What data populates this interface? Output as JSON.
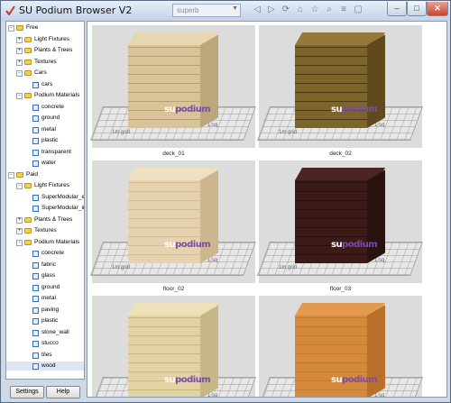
{
  "window": {
    "title": "SU Podium Browser V2",
    "toolbar_select": "superb"
  },
  "sidebar": {
    "tree": [
      {
        "label": "Free",
        "type": "folder",
        "level": 0,
        "expander": "-"
      },
      {
        "label": "Light Fixtures",
        "type": "folder",
        "level": 1,
        "expander": "+"
      },
      {
        "label": "Plants & Trees",
        "type": "folder",
        "level": 1,
        "expander": "+"
      },
      {
        "label": "Textures",
        "type": "folder",
        "level": 1,
        "expander": "+"
      },
      {
        "label": "Cars",
        "type": "folder",
        "level": 1,
        "expander": "-"
      },
      {
        "label": "cars",
        "type": "item",
        "level": 2
      },
      {
        "label": "Podium Materials",
        "type": "folder",
        "level": 1,
        "expander": "-"
      },
      {
        "label": "concrete",
        "type": "item",
        "level": 2
      },
      {
        "label": "ground",
        "type": "item",
        "level": 2
      },
      {
        "label": "metal",
        "type": "item",
        "level": 2
      },
      {
        "label": "plastic",
        "type": "item",
        "level": 2
      },
      {
        "label": "transparent",
        "type": "item",
        "level": 2
      },
      {
        "label": "water",
        "type": "item",
        "level": 2
      },
      {
        "label": "Paid",
        "type": "folder",
        "level": 0,
        "expander": "-"
      },
      {
        "label": "Light Fixtures",
        "type": "folder",
        "level": 1,
        "expander": "-"
      },
      {
        "label": "SuperModular_exterior",
        "type": "item",
        "level": 2
      },
      {
        "label": "SuperModular_interior",
        "type": "item",
        "level": 2
      },
      {
        "label": "Plants & Trees",
        "type": "folder",
        "level": 1,
        "expander": "+"
      },
      {
        "label": "Textures",
        "type": "folder",
        "level": 1,
        "expander": "+"
      },
      {
        "label": "Podium Materials",
        "type": "folder",
        "level": 1,
        "expander": "-"
      },
      {
        "label": "concrete",
        "type": "item",
        "level": 2
      },
      {
        "label": "fabric",
        "type": "item",
        "level": 2
      },
      {
        "label": "glass",
        "type": "item",
        "level": 2
      },
      {
        "label": "ground",
        "type": "item",
        "level": 2
      },
      {
        "label": "metal",
        "type": "item",
        "level": 2
      },
      {
        "label": "paving",
        "type": "item",
        "level": 2
      },
      {
        "label": "plastic",
        "type": "item",
        "level": 2
      },
      {
        "label": "stone_wall",
        "type": "item",
        "level": 2
      },
      {
        "label": "stucco",
        "type": "item",
        "level": 2
      },
      {
        "label": "tiles",
        "type": "item",
        "level": 2
      },
      {
        "label": "wood",
        "type": "item",
        "level": 2,
        "selected": true
      }
    ]
  },
  "buttons": {
    "settings": "Settings",
    "help": "Help"
  },
  "gallery": {
    "logo_prefix": "su",
    "logo_suffix": "podium",
    "grid_label_left": "1m grid",
    "grid_label_right": "1 sq",
    "items": [
      {
        "caption": "deck_01",
        "front": "#d9c49a",
        "side": "#bca67a",
        "top": "#e6d6b2",
        "lines": "#b79f72"
      },
      {
        "caption": "deck_02",
        "front": "#7d6428",
        "side": "#5f4a1d",
        "top": "#94793a",
        "lines": "#4a3a14"
      },
      {
        "caption": "floor_02",
        "front": "#e6d2ae",
        "side": "#cdb68e",
        "top": "#efe0c2",
        "lines": "#d2bc96"
      },
      {
        "caption": "floor_03",
        "front": "#3b1a18",
        "side": "#2a1210",
        "top": "#4a2522",
        "lines": "#2c100f"
      },
      {
        "caption": "",
        "front": "#e3d2a4",
        "side": "#c9b887",
        "top": "#eee0b8",
        "lines": "#cab682"
      },
      {
        "caption": "",
        "front": "#d4893b",
        "side": "#b8702a",
        "top": "#e19a4e",
        "lines": "#c07a32"
      }
    ]
  }
}
